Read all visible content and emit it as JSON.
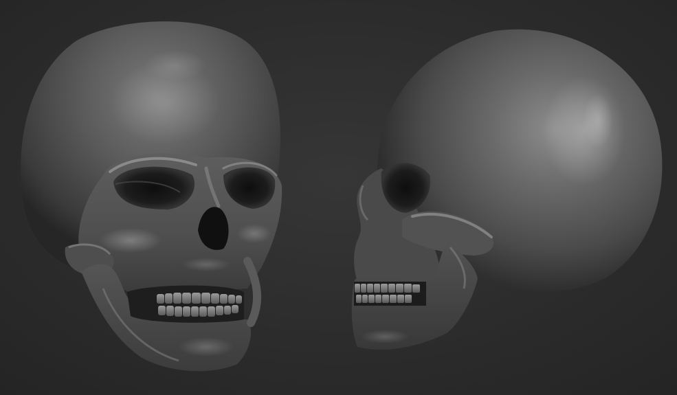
{
  "scene": {
    "subject": "skull-render",
    "views": [
      {
        "id": "three-quarter-front",
        "label": ""
      },
      {
        "id": "side-profile",
        "label": ""
      }
    ],
    "colors": {
      "background_center": "#363636",
      "background_edge": "#242424",
      "bone_highlight": "#9a9a9a",
      "bone_mid": "#5c5c5c",
      "bone_shadow": "#262626",
      "cavity": "#121212",
      "teeth": "#8a8a8a"
    }
  }
}
